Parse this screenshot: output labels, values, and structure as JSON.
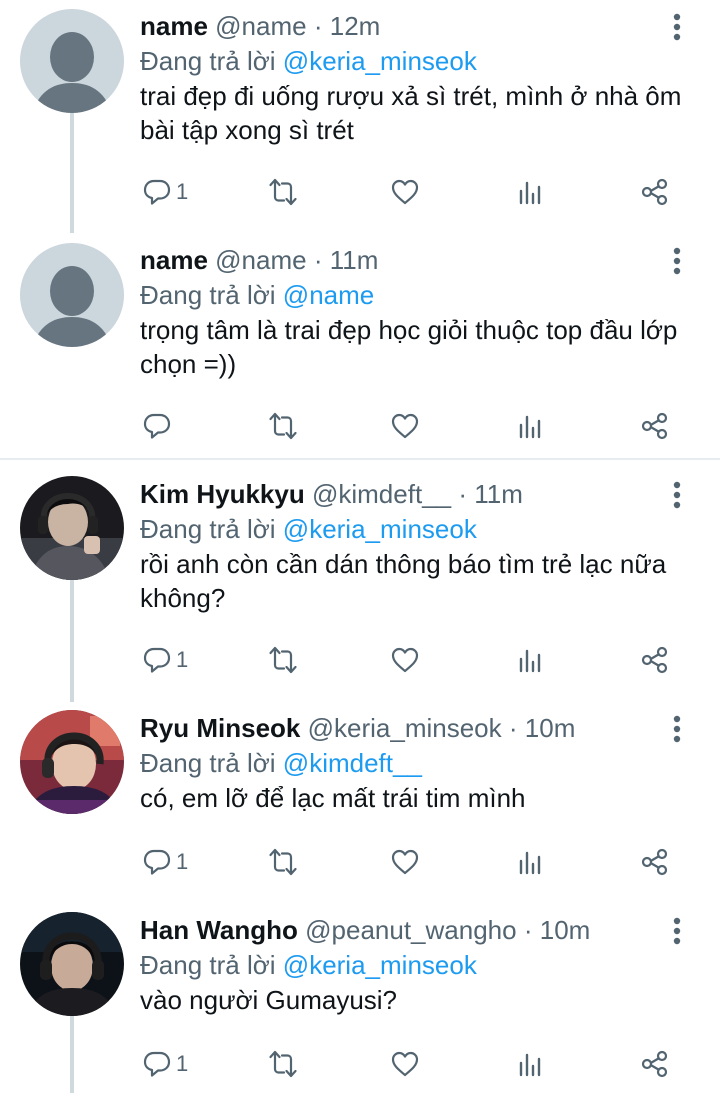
{
  "tweets": [
    {
      "name": "name",
      "handle": "@name",
      "separator": "·",
      "time": "12m",
      "reply_prefix": "Đang trả lời",
      "reply_to": "@keria_minseok",
      "text": "trai đẹp đi uống rượu xả sì trét, mình ở nhà ôm bài tập xong sì trét",
      "reply_count": "1",
      "avatar": "default-avatar"
    },
    {
      "name": "name",
      "handle": "@name",
      "separator": "·",
      "time": "11m",
      "reply_prefix": "Đang trả lời",
      "reply_to": "@name",
      "text": "trọng tâm là trai đẹp học giỏi thuộc top đầu lớp chọn =))",
      "reply_count": "",
      "avatar": "default-avatar"
    },
    {
      "name": "Kim Hyukkyu",
      "handle": "@kimdeft__",
      "separator": "·",
      "time": "11m",
      "reply_prefix": "Đang trả lời",
      "reply_to": "@keria_minseok",
      "text": "rồi anh còn cần dán thông báo tìm trẻ lạc nữa không?",
      "reply_count": "1",
      "avatar": "photo-avatar"
    },
    {
      "name": "Ryu Minseok",
      "handle": "@keria_minseok",
      "separator": "·",
      "time": "10m",
      "reply_prefix": "Đang trả lời",
      "reply_to": "@kimdeft__",
      "text": "có, em lỡ để lạc mất trái tim mình",
      "reply_count": "1",
      "avatar": "photo-avatar"
    },
    {
      "name": "Han Wangho",
      "handle": "@peanut_wangho",
      "separator": "·",
      "time": "10m",
      "reply_prefix": "Đang trả lời",
      "reply_to": "@keria_minseok",
      "text": "vào người Gumayusi?",
      "reply_count": "1",
      "avatar": "photo-avatar"
    }
  ],
  "icons": {
    "reply": "reply-icon",
    "retweet": "retweet-icon",
    "like": "heart-icon",
    "views": "analytics-icon",
    "share": "share-icon",
    "more": "more-vertical-icon"
  },
  "colors": {
    "mention": "#1d9bf0",
    "secondary_text": "#536471",
    "primary_text": "#0f1419",
    "thread_line": "#cfd9de",
    "divider": "#e6ecf0"
  }
}
